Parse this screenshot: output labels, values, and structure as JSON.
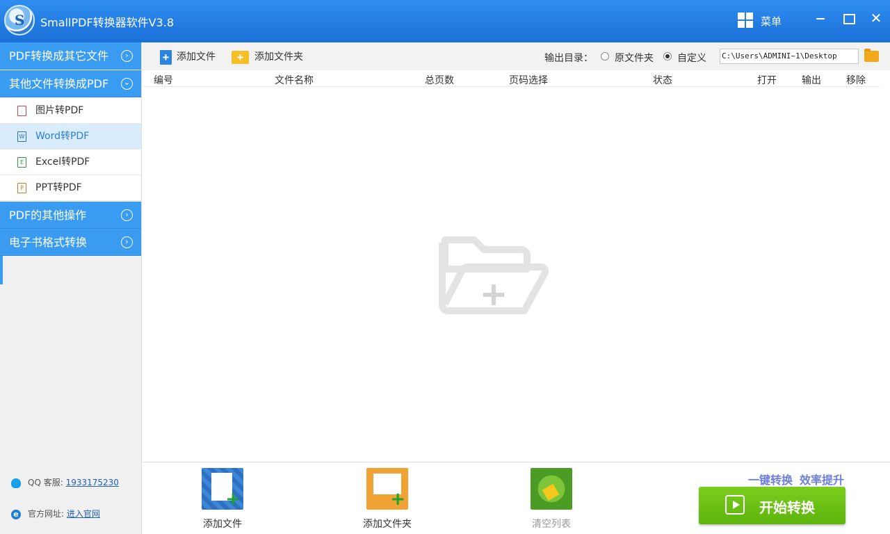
{
  "window": {
    "title": "SmallPDF转换器软件V3.8",
    "logo_letter": "S",
    "menu_label": "菜单",
    "close_glyph": "✕"
  },
  "sidebar": {
    "categories": [
      {
        "label": "PDF转换成其它文件",
        "icon": "chevron-right-circle-icon",
        "glyph": "›"
      },
      {
        "label": "其他文件转换成PDF",
        "icon": "chevron-down-circle-icon",
        "glyph": "⌄"
      },
      {
        "label": "PDF的其他操作",
        "icon": "chevron-right-circle-icon",
        "glyph": "›"
      },
      {
        "label": "电子书格式转换",
        "icon": "chevron-right-circle-icon",
        "glyph": "›"
      }
    ],
    "subitems": [
      {
        "label": "图片转PDF",
        "icon": "image-file-icon",
        "glyph": ""
      },
      {
        "label": "Word转PDF",
        "icon": "word-file-icon",
        "glyph": "W"
      },
      {
        "label": "Excel转PDF",
        "icon": "excel-file-icon",
        "glyph": "E"
      },
      {
        "label": "PPT转PDF",
        "icon": "ppt-file-icon",
        "glyph": "P"
      }
    ],
    "active_subitem": "Word转PDF",
    "qq_label": "QQ 客服:",
    "qq_number": "1933175230",
    "site_label": "官方网址:",
    "site_link": "进入官网"
  },
  "toolbar": {
    "add_file": "添加文件",
    "add_folder": "添加文件夹",
    "output_label": "输出目录：",
    "radio_original": "原文件夹",
    "radio_custom": "自定义",
    "selected_radio": "自定义",
    "output_path": "C:\\Users\\ADMINI~1\\Desktop"
  },
  "table": {
    "headers": [
      "编号",
      "文件名称",
      "总页数",
      "页码选择",
      "状态",
      "打开",
      "输出",
      "移除"
    ],
    "rows": []
  },
  "footer": {
    "add_file": "添加文件",
    "add_folder": "添加文件夹",
    "clear_list": "清空列表",
    "slogan_1": "一键转换",
    "slogan_2": "效率提升",
    "start_button": "开始转换"
  },
  "colors": {
    "title_bar": "#1b6fd8",
    "sidebar_category": "#3a9cf0",
    "active_item_bg": "#d9ecfb",
    "start_button": "#6cc015",
    "slogan": "#6d7fd8"
  }
}
